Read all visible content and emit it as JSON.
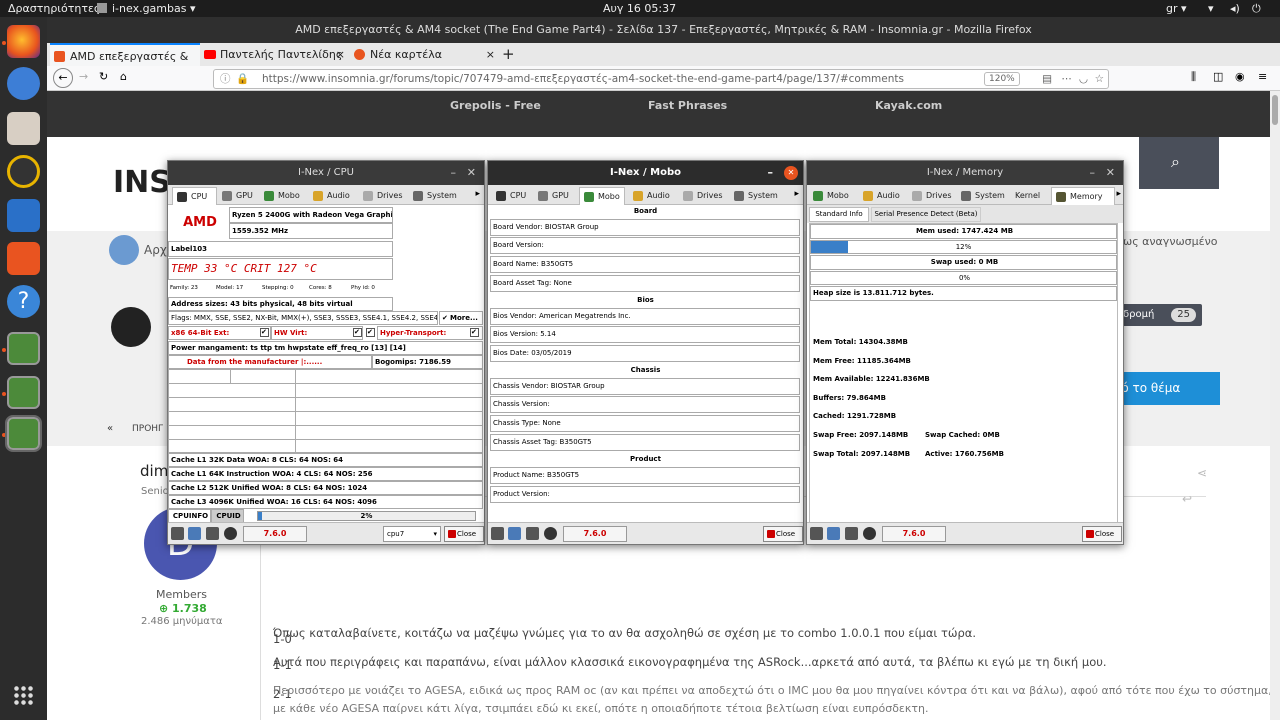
{
  "topbar": {
    "activities": "Δραστηριότητες",
    "app_menu": "i-nex.gambas ▾",
    "clock": "Αυγ 16  05:37",
    "lang": "gr ▾"
  },
  "firefox": {
    "window_title": "AMD επεξεργαστές & AM4 socket (The End Game Part4) - Σελίδα 137 - Επεξεργαστές, Μητρικές & RAM - Insomnia.gr - Mozilla Firefox",
    "tabs": [
      {
        "label": "AMD επεξεργαστές & AM",
        "close": "×"
      },
      {
        "label": "Παντελής Παντελίδης",
        "close": "×"
      },
      {
        "label": "Νέα καρτέλα",
        "close": "×"
      }
    ],
    "new_tab": "+",
    "url": "https://www.insomnia.gr/forums/topic/707479-amd-επεξεργαστές-am4-socket-the-end-game-part4/page/137/#comments",
    "zoom": "120%"
  },
  "page": {
    "ads": [
      "Grepolis - Free",
      "Fast Phrases",
      "Kayak.com"
    ],
    "site_logo": "INS",
    "breadcrumb_prefix": "Αρχ",
    "right_snippet": "ως αναγνωσμένο",
    "follow_label": "δρομή",
    "follow_count": "25",
    "reply_button": "ε αυτό το θέμα",
    "prev_label": "ΠΡΟΗΓ",
    "author_name": "dim",
    "author_rank": "Senio",
    "author_avatar_letter": "D",
    "author_group": "Members",
    "author_rep": "1.738",
    "author_posts": "2.486 μηνύματα",
    "post_lines": [
      "1-0",
      "1-1",
      "2-1",
      "Όπως καταλαβαίνετε, κοιτάζω να μαζέψω γνώμες για το αν θα ασχοληθώ σε σχέση με το combo 1.0.0.1 που είμαι τώρα.",
      "Αυτά που περιγράφεις και παραπάνω, είναι μάλλον κλασσικά εικονογραφημένα της ASRock...αρκετά από αυτά, τα βλέπω κι εγώ με τη δική μου.",
      "Περισσότερο με νοιάζει το AGESA, ειδικά ως προς RAM oc (αν και πρέπει να αποδεχτώ ότι ο IMC μου θα μου πηγαίνει κόντρα ότι και να βάλω), αφού από τότε που έχω το σύστημα,",
      "με κάθε νέο AGESA παίρνει κάτι λίγα, τσιμπάει εδώ κι εκεί, οπότε η οποιαδήποτε τέτοια βελτίωση είναι ευπρόσδεκτη."
    ]
  },
  "cpu_window": {
    "title": "I-Nex / CPU",
    "tabs": [
      "CPU",
      "GPU",
      "Mobo",
      "Audio",
      "Drives",
      "System"
    ],
    "vendor_logo": "AMD",
    "model": "Ryzen 5 2400G with Radeon Vega Graphic",
    "freq": "1559.352 MHz",
    "label": "Label103",
    "temp": "TEMP 33 °C CRIT 127 °C",
    "family": "Family: 23",
    "model_no": "Model: 17",
    "stepping": "Stepping: 0",
    "cores": "Cores: 8",
    "phy_id": "Phy id: 0",
    "address_sizes": "Address sizes: 43 bits physical, 48 bits virtual",
    "flags": "Flags: MMX, SSE, SSE2, NX-Bit, MMX(+), SSE3, SSSE3, SSE4.1, SSE4.2, SSE4a,",
    "more_button": "More...",
    "x86_64": "x86 64-Bit Ext:",
    "hw_virt": "HW Virt:",
    "hyper_transport": "Hyper-Transport:",
    "power": "Power mangament: ts ttp tm hwpstate eff_freq_ro [13] [14]",
    "manufacturer": "Data from the manufacturer |:......",
    "bogomips": "Bogomips: 7186.59",
    "caches": [
      "Cache L1  32K  Data  WOA: 8  CLS: 64  NOS: 64",
      "Cache L1  64K  Instruction  WOA: 4  CLS: 64  NOS: 256",
      "Cache L2  512K  Unified  WOA: 8  CLS: 64  NOS: 1024",
      "Cache L3  4096K  Unified  WOA: 16  CLS: 64  NOS: 4096"
    ],
    "bottom_tabs": [
      "CPUINFO",
      "CPUID"
    ],
    "usage_text": "2%",
    "usage_fraction": 0.02,
    "version": "7.6.0",
    "cpu_select": "cpu7",
    "close": "Close"
  },
  "mobo_window": {
    "title": "I-Nex / Mobo",
    "tabs": [
      "CPU",
      "GPU",
      "Mobo",
      "Audio",
      "Drives",
      "System"
    ],
    "board_header": "Board",
    "board_vendor": "Board Vendor:   BIOSTAR Group",
    "board_version": "Board Version:",
    "board_name": "Board Name:   B350GT5",
    "board_asset": "Board Asset Tag:   None",
    "bios_header": "Bios",
    "bios_vendor": "Bios Vendor:   American Megatrends Inc.",
    "bios_version": "Bios Version:   5.14",
    "bios_date": "Bios Date:   03/05/2019",
    "chassis_header": "Chassis",
    "chassis_vendor": "Chassis Vendor:   BIOSTAR Group",
    "chassis_version": "Chassis Version:",
    "chassis_type": "Chassis Type:   None",
    "chassis_asset": "Chassis Asset Tag:   B350GT5",
    "product_header": "Product",
    "product_name": "Product Name:   B350GT5",
    "product_version": "Product Version:",
    "version": "7.6.0",
    "close": "Close"
  },
  "mem_window": {
    "title": "I-Nex / Memory",
    "tabs": [
      "Mobo",
      "Audio",
      "Drives",
      "System",
      "Kernel",
      "Memory"
    ],
    "subtabs": [
      "Standard Info",
      "Serial Presence Detect (Beta)"
    ],
    "mem_used": "Mem used: 1747.424 MB",
    "mem_pct": "12%",
    "mem_fraction": 0.12,
    "swap_used": "Swap used: 0 MB",
    "swap_pct": "0%",
    "heap": "Heap size is 13.811.712 bytes.",
    "mem_total": "Mem Total: 14304.38MB",
    "mem_free": "Mem Free: 11185.364MB",
    "mem_available": "Mem Available: 12241.836MB",
    "buffers": "Buffers: 79.864MB",
    "cached": "Cached: 1291.728MB",
    "swap_free": "Swap Free: 2097.148MB",
    "swap_cached": "Swap Cached: 0MB",
    "swap_total": "Swap Total: 2097.148MB",
    "active": "Active: 1760.756MB",
    "version": "7.6.0",
    "close": "Close"
  }
}
